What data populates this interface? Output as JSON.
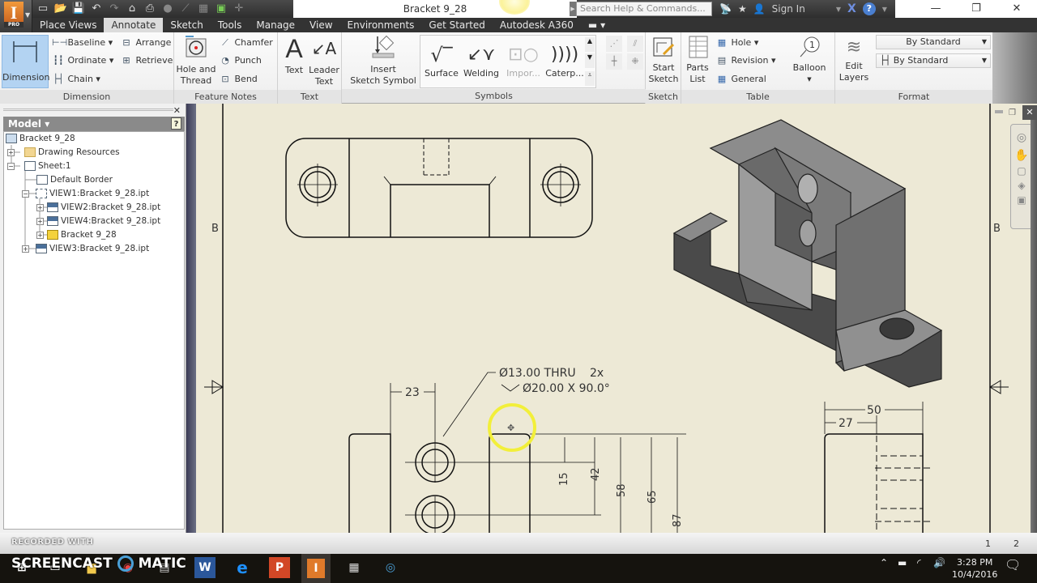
{
  "app": {
    "logo_text": "I",
    "logo_badge": "PRO",
    "document_title": "Bracket 9_28",
    "search_placeholder": "Search Help & Commands...",
    "sign_in": "Sign In",
    "quick_access": [
      "new-icon",
      "open-icon",
      "save-icon",
      "undo-icon",
      "redo-icon",
      "home-icon",
      "print-icon",
      "appearance-icon",
      "measure-icon",
      "update-icon",
      "select-icon",
      "customize-icon"
    ]
  },
  "tabs": [
    {
      "label": "Place Views",
      "active": false
    },
    {
      "label": "Annotate",
      "active": true
    },
    {
      "label": "Sketch",
      "active": false
    },
    {
      "label": "Tools",
      "active": false
    },
    {
      "label": "Manage",
      "active": false
    },
    {
      "label": "View",
      "active": false
    },
    {
      "label": "Environments",
      "active": false
    },
    {
      "label": "Get Started",
      "active": false
    },
    {
      "label": "Autodesk A360",
      "active": false
    }
  ],
  "ribbon": {
    "dimension": {
      "panel_label": "Dimension",
      "main": "Dimension",
      "baseline": "Baseline",
      "ordinate": "Ordinate",
      "chain": "Chain",
      "arrange": "Arrange",
      "retrieve": "Retrieve"
    },
    "feature_notes": {
      "panel_label": "Feature Notes",
      "hole_thread_1": "Hole and",
      "hole_thread_2": "Thread",
      "chamfer": "Chamfer",
      "punch": "Punch",
      "bend": "Bend"
    },
    "text": {
      "panel_label": "Text",
      "text": "Text",
      "leader_1": "Leader",
      "leader_2": "Text"
    },
    "symbols": {
      "panel_label": "Symbols",
      "insert_1": "Insert",
      "insert_2": "Sketch Symbol",
      "surface": "Surface",
      "welding": "Welding",
      "import": "Impor...",
      "caterpillar": "Caterp..."
    },
    "sketch": {
      "panel_label": "Sketch",
      "start_1": "Start",
      "start_2": "Sketch"
    },
    "table": {
      "panel_label": "Table",
      "parts_1": "Parts",
      "parts_2": "List",
      "hole": "Hole",
      "revision": "Revision",
      "general": "General"
    },
    "balloon": {
      "label": "Balloon",
      "number": "1"
    },
    "format": {
      "panel_label": "Format",
      "edit_1": "Edit",
      "edit_2": "Layers",
      "style_1": "By Standard",
      "style_2": "By Standard"
    }
  },
  "browser": {
    "title": "Model",
    "help": "?",
    "nodes": [
      {
        "label": "Bracket 9_28",
        "level": 0,
        "expander": ""
      },
      {
        "label": "Drawing Resources",
        "level": 1,
        "expander": "+"
      },
      {
        "label": "Sheet:1",
        "level": 1,
        "expander": "−"
      },
      {
        "label": "Default Border",
        "level": 2,
        "expander": ""
      },
      {
        "label": "VIEW1:Bracket 9_28.ipt",
        "level": 2,
        "expander": "−"
      },
      {
        "label": "VIEW2:Bracket 9_28.ipt",
        "level": 3,
        "expander": "+"
      },
      {
        "label": "VIEW4:Bracket 9_28.ipt",
        "level": 3,
        "expander": "+"
      },
      {
        "label": "Bracket 9_28",
        "level": 3,
        "expander": "+"
      },
      {
        "label": "VIEW3:Bracket 9_28.ipt",
        "level": 2,
        "expander": "+"
      }
    ]
  },
  "drawing": {
    "zone_left": "B",
    "zone_right": "B",
    "hole_note_1": "Ø13.00 THRU",
    "hole_note_qty": "2x",
    "hole_note_2": "Ø20.00 X 90.0°",
    "dim_23": "23",
    "dim_15": "15",
    "dim_42": "42",
    "dim_58": "58",
    "dim_65": "65",
    "dim_87": "87",
    "dim_50": "50",
    "dim_27": "27"
  },
  "status": {
    "page_1": "1",
    "page_2": "2"
  },
  "recording": {
    "label": "RECORDED WITH",
    "brand": "SCREENCAST",
    "brand_2": "MATIC"
  },
  "taskbar": {
    "apps": [
      "start-icon",
      "task-view-icon",
      "file-explorer-icon",
      "chrome-icon",
      "notepad-icon",
      "word-icon",
      "edge-icon",
      "powerpoint-icon",
      "inventor-icon",
      "calculator-icon",
      "screencast-icon"
    ],
    "time": "3:28 PM",
    "date": "10/4/2016"
  }
}
